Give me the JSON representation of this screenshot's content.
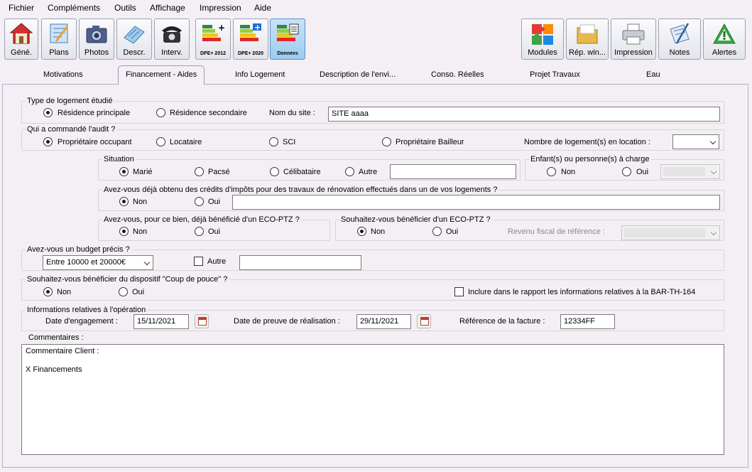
{
  "menu": [
    "Fichier",
    "Compléments",
    "Outils",
    "Affichage",
    "Impression",
    "Aide"
  ],
  "toolbar_left": [
    {
      "label": "Géné.",
      "icon": "house-icon"
    },
    {
      "label": "Plans",
      "icon": "plans-icon"
    },
    {
      "label": "Photos",
      "icon": "camera-icon"
    },
    {
      "label": "Descr.",
      "icon": "description-icon"
    },
    {
      "label": "Interv.",
      "icon": "phone-icon"
    },
    {
      "label": "DPE+ 2012",
      "icon": "dpe-label-icon"
    },
    {
      "label": "DPE+ 2020",
      "icon": "dpe-label-icon"
    },
    {
      "label": "Données",
      "icon": "dpe-data-icon"
    }
  ],
  "toolbar_right": [
    {
      "label": "Modules",
      "icon": "puzzle-icon"
    },
    {
      "label": "Rép. win...",
      "icon": "folder-icon"
    },
    {
      "label": "Impression",
      "icon": "printer-icon"
    },
    {
      "label": "Notes",
      "icon": "notes-icon"
    },
    {
      "label": "Alertes",
      "icon": "alert-icon"
    }
  ],
  "tabs": [
    "Motivations",
    "Financement - Aides",
    "Info Logement",
    "Description de l'envi...",
    "Conso. Réelles",
    "Projet Travaux",
    "Eau"
  ],
  "logement": {
    "title": "Type de logement étudié",
    "opt1": "Résidence principale",
    "opt2": "Résidence secondaire",
    "site_label": "Nom du site :",
    "site_value": "SITE aaaa"
  },
  "audit": {
    "title": "Qui a commandé l'audit ?",
    "opt1": "Propriétaire occupant",
    "opt2": "Locataire",
    "opt3": "SCI",
    "opt4": "Propriétaire Bailleur",
    "location_label": "Nombre de logement(s) en location :"
  },
  "situation": {
    "title": "Situation",
    "opt1": "Marié",
    "opt2": "Pacsé",
    "opt3": "Célibataire",
    "opt4": "Autre"
  },
  "enfants": {
    "title": "Enfant(s) ou personne(s) à charge",
    "opt1": "Non",
    "opt2": "Oui"
  },
  "credits": {
    "title": "Avez-vous déjà obtenu des crédits d'impôts pour des travaux de rénovation effectués dans un de vos logements ?",
    "opt1": "Non",
    "opt2": "Oui"
  },
  "ecoptz_deja": {
    "title": "Avez-vous, pour ce bien, déjà bénéficié d'un ECO-PTZ ?",
    "opt1": "Non",
    "opt2": "Oui"
  },
  "ecoptz_souhait": {
    "title": "Souhaitez-vous bénéficier d'un ECO-PTZ ?",
    "opt1": "Non",
    "opt2": "Oui",
    "revenu_label": "Revenu fiscal de référence :"
  },
  "budget": {
    "title": "Avez-vous un budget précis ?",
    "value": "Entre 10000 et 20000€",
    "autre_label": "Autre"
  },
  "coup_de_pouce": {
    "title": "Souhaitez-vous bénéficier du dispositif \"Coup de pouce\" ?",
    "opt1": "Non",
    "opt2": "Oui",
    "include_label": "Inclure dans le rapport les informations relatives à la BAR-TH-164"
  },
  "operation": {
    "title": "Informations relatives à l'opération",
    "engagement_label": "Date d'engagement :",
    "engagement_value": "15/11/2021",
    "preuve_label": "Date de preuve de réalisation :",
    "preuve_value": "29/11/2021",
    "facture_label": "Référence de la facture :",
    "facture_value": "12334FF"
  },
  "comments": {
    "label": "Commentaires :",
    "line1": "Commentaire Client :",
    "line2": "",
    "line3": "X Financements"
  }
}
